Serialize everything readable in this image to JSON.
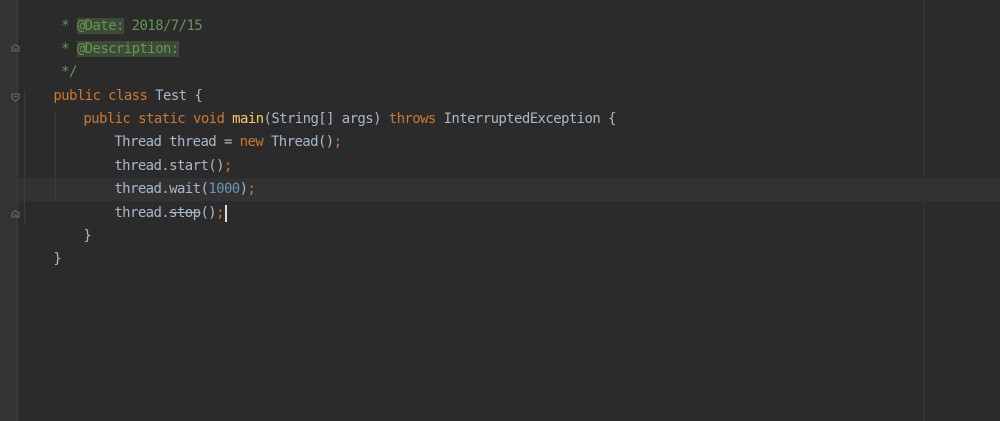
{
  "editor": {
    "lines": [
      {
        "comment_prefix": " * ",
        "tag": "@Date:",
        "text": " 2018/7/15"
      },
      {
        "comment_prefix": " * ",
        "tag": "@Description:",
        "text": ""
      },
      {
        "comment_close": " */"
      },
      {
        "kw1": "public",
        "kw2": "class",
        "name": "Test",
        "brace": "{"
      },
      {
        "kw1": "public",
        "kw2": "static",
        "kw3": "void",
        "method": "main",
        "params": "(String[] args)",
        "throws_kw": "throws",
        "exception": "InterruptedException",
        "brace": "{"
      },
      {
        "type": "Thread",
        "var": "thread",
        "assign": " = ",
        "new_kw": "new",
        "ctor": " Thread()",
        "semi": ";"
      },
      {
        "obj": "thread.start()",
        "semi": ";"
      },
      {
        "obj": "thread.wait(",
        "number": "1000",
        "close": ")",
        "semi": ";"
      },
      {
        "obj": "thread.",
        "deprecated_method": "stop",
        "close": "()",
        "semi": ";"
      },
      {
        "brace": "}"
      },
      {
        "brace": "}"
      }
    ]
  },
  "colors": {
    "background": "#2b2b2b",
    "gutter": "#313335",
    "keyword": "#cc7832",
    "method": "#ffc66d",
    "number": "#6897bb",
    "doc_comment": "#629755",
    "text": "#a9b7c6"
  },
  "icons": {
    "fold_open": "fold-open-icon",
    "fold_close": "fold-close-icon"
  }
}
